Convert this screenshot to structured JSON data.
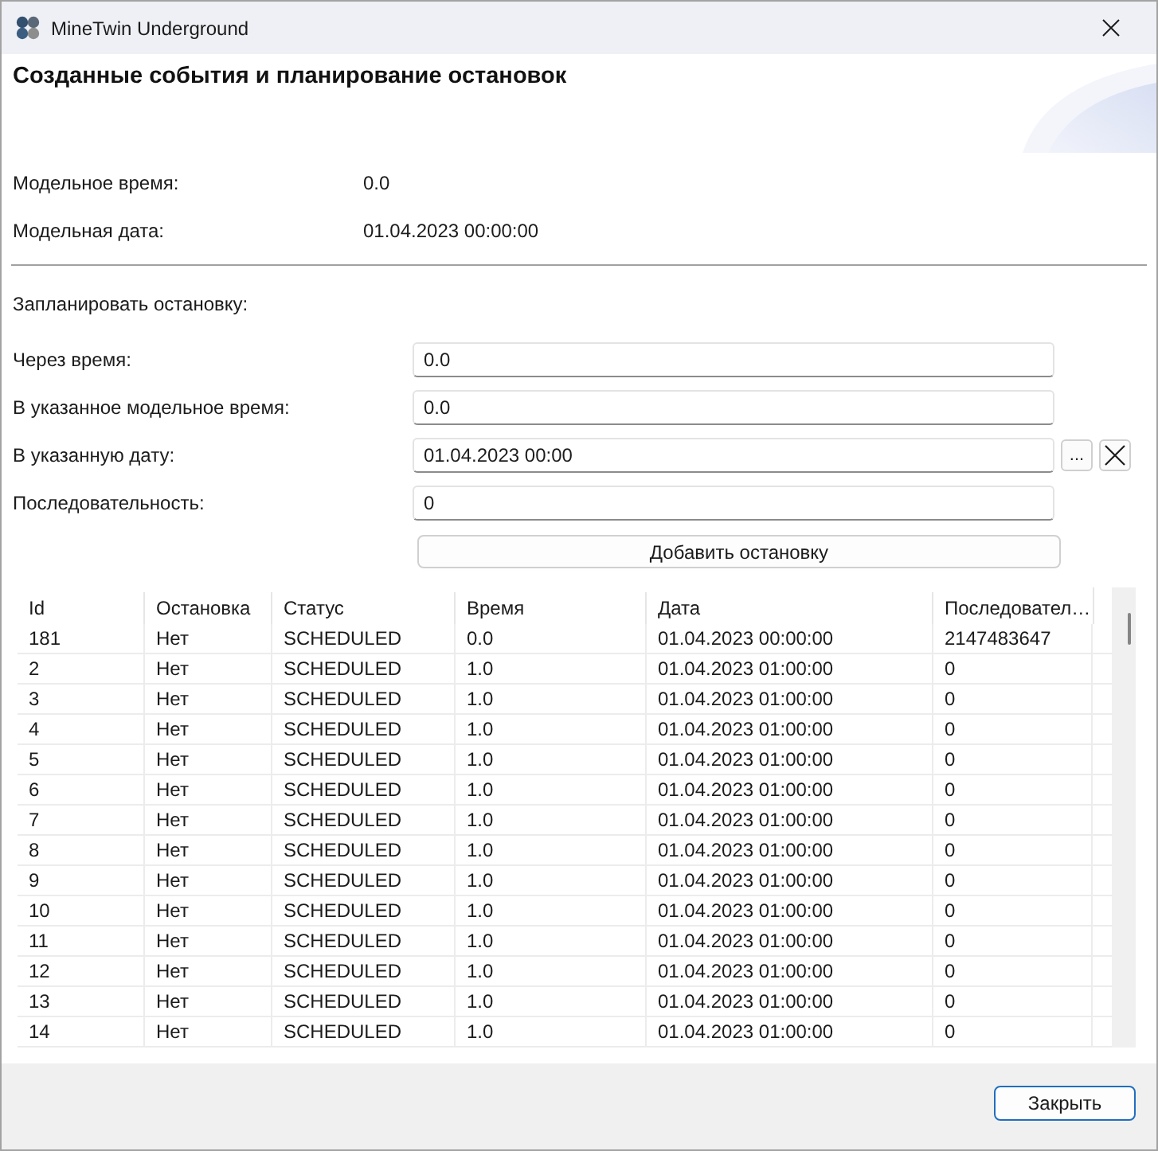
{
  "window": {
    "title": "MineTwin Underground"
  },
  "header": {
    "title": "Созданные события и планирование остановок"
  },
  "model_info": [
    {
      "label": "Модельное время:",
      "value": "0.0"
    },
    {
      "label": "Модельная дата:",
      "value": "01.04.2023 00:00:00"
    }
  ],
  "schedule": {
    "title": "Запланировать остановку:",
    "fields": [
      {
        "kind": "number",
        "label": "Через время:",
        "value": "0.0"
      },
      {
        "kind": "number",
        "label": "В указанное модельное время:",
        "value": "0.0"
      },
      {
        "kind": "date",
        "label": "В указанную дату:",
        "value": "01.04.2023 00:00",
        "picker_label": "..."
      },
      {
        "kind": "number",
        "label": "Последовательность:",
        "value": "0"
      }
    ],
    "add_button": "Добавить остановку"
  },
  "table": {
    "columns": [
      "Id",
      "Остановка",
      "Статус",
      "Время",
      "Дата",
      "Последовател…"
    ],
    "rows": [
      [
        "181",
        "Нет",
        "SCHEDULED",
        "0.0",
        "01.04.2023 00:00:00",
        "2147483647"
      ],
      [
        "2",
        "Нет",
        "SCHEDULED",
        "1.0",
        "01.04.2023 01:00:00",
        "0"
      ],
      [
        "3",
        "Нет",
        "SCHEDULED",
        "1.0",
        "01.04.2023 01:00:00",
        "0"
      ],
      [
        "4",
        "Нет",
        "SCHEDULED",
        "1.0",
        "01.04.2023 01:00:00",
        "0"
      ],
      [
        "5",
        "Нет",
        "SCHEDULED",
        "1.0",
        "01.04.2023 01:00:00",
        "0"
      ],
      [
        "6",
        "Нет",
        "SCHEDULED",
        "1.0",
        "01.04.2023 01:00:00",
        "0"
      ],
      [
        "7",
        "Нет",
        "SCHEDULED",
        "1.0",
        "01.04.2023 01:00:00",
        "0"
      ],
      [
        "8",
        "Нет",
        "SCHEDULED",
        "1.0",
        "01.04.2023 01:00:00",
        "0"
      ],
      [
        "9",
        "Нет",
        "SCHEDULED",
        "1.0",
        "01.04.2023 01:00:00",
        "0"
      ],
      [
        "10",
        "Нет",
        "SCHEDULED",
        "1.0",
        "01.04.2023 01:00:00",
        "0"
      ],
      [
        "11",
        "Нет",
        "SCHEDULED",
        "1.0",
        "01.04.2023 01:00:00",
        "0"
      ],
      [
        "12",
        "Нет",
        "SCHEDULED",
        "1.0",
        "01.04.2023 01:00:00",
        "0"
      ],
      [
        "13",
        "Нет",
        "SCHEDULED",
        "1.0",
        "01.04.2023 01:00:00",
        "0"
      ],
      [
        "14",
        "Нет",
        "SCHEDULED",
        "1.0",
        "01.04.2023 01:00:00",
        "0"
      ]
    ]
  },
  "footer": {
    "buttons": [
      "Закрыть"
    ]
  }
}
